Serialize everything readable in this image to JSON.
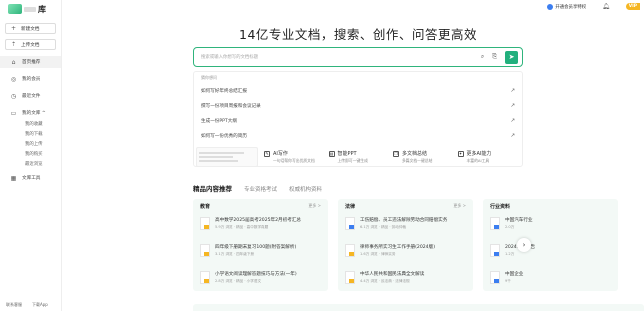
{
  "logo": {
    "text": "库"
  },
  "sidebar": {
    "buttons": [
      {
        "label": "新建文档",
        "icon": "plus-icon"
      },
      {
        "label": "上传文档",
        "icon": "upload-icon"
      }
    ],
    "items": [
      {
        "label": "首页推荐",
        "icon": "home-icon"
      },
      {
        "label": "我的会员",
        "icon": "vip-icon"
      },
      {
        "label": "最近文件",
        "icon": "clock-icon"
      }
    ],
    "library": {
      "label": "我的文库 ^",
      "icon": "folder-icon"
    },
    "sub_items": [
      "我的收藏",
      "我的下载",
      "我的上传",
      "我的购买",
      "最近浏览"
    ],
    "tools": {
      "label": "文库工具",
      "icon": "grid-icon"
    },
    "footer": [
      "联系客服",
      "下载App"
    ]
  },
  "top": {
    "vip_text": "开通会员享特权",
    "vip_badge": "VIP"
  },
  "headline": "14亿专业文档，搜索、创作、问答更高效",
  "search": {
    "placeholder": "搜索或输入你想写的文档标题"
  },
  "suggest": {
    "header": "猜你想问",
    "items": [
      "如何写好年终总结汇报",
      "撰写一份项目周报和会议记录",
      "生成一份PPT大纲",
      "如何写一份优秀的简历"
    ]
  },
  "features": [
    {
      "title": "AI写作",
      "sub": "一句话帮你写出优质文档",
      "icon": "ai-write-icon"
    },
    {
      "title": "智能PPT",
      "sub": "上传即可一键生成",
      "icon": "ppt-icon"
    },
    {
      "title": "多文档总结",
      "sub": "多篇文档一键总结",
      "icon": "multi-doc-icon"
    },
    {
      "title": "更多AI能力",
      "sub": "丰富的AI工具",
      "icon": "more-ai-icon"
    }
  ],
  "tabs": [
    "精品内容推荐",
    "专业资格考试",
    "权威机构资料"
  ],
  "cards": [
    {
      "title": "教育",
      "more": "更多 >",
      "docs": [
        {
          "title": "高中数学2025届高考2025年2月初考汇总",
          "meta": "5.9万 浏览 · 精品 · 高中数学真题"
        },
        {
          "title": "四年级下册期末复习100题(附答案解析)",
          "meta": "3.1万 浏览 · 四年级下册"
        },
        {
          "title": "小学语文阅读理解答题技巧与方法(一年)",
          "meta": "2.8万 浏览 · 精品 · 小学语文"
        }
      ]
    },
    {
      "title": "法律",
      "more": "更多 >",
      "docs": [
        {
          "title": "工伤赔偿、员工违法解除劳动合同赔偿实务",
          "meta": "6.1万 浏览 · 精品 · 劳动仲裁"
        },
        {
          "title": "律师事务所实习生工作手册(2024版)",
          "meta": "1.6万 浏览 · 律师实务"
        },
        {
          "title": "中华人民共和国民法典全文解读",
          "meta": "4.4万 浏览 · 民法典 · 法律法规"
        }
      ]
    },
    {
      "title": "行业资料",
      "more": "",
      "docs": [
        {
          "title": "中国汽车行业",
          "meta": "2.0万"
        },
        {
          "title": "2024年度报告",
          "meta": "1.2万"
        },
        {
          "title": "中国企业",
          "meta": "9千"
        }
      ]
    }
  ]
}
